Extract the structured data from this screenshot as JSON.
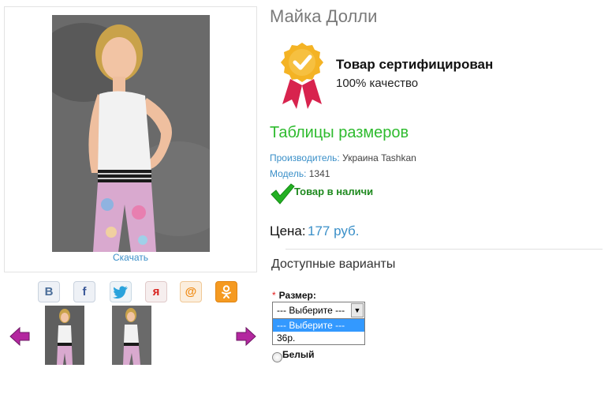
{
  "product": {
    "title": "Майка Долли",
    "download_label": "Скачать",
    "certificate": {
      "title": "Товар сертифицирован",
      "subtitle": "100% качество"
    },
    "size_tables_link": "Таблицы размеров",
    "manufacturer_label": "Производитель:",
    "manufacturer_value": "Украина Tashkan",
    "model_label": "Модель:",
    "model_value": "1341",
    "stock_status": "Товар в наличи",
    "price_label": "Цена:",
    "price_value": "177 руб."
  },
  "social": [
    {
      "icon": "vk-icon",
      "glyph": "В"
    },
    {
      "icon": "facebook-icon",
      "glyph": "f"
    },
    {
      "icon": "twitter-icon",
      "glyph": "🐦"
    },
    {
      "icon": "yaru-icon",
      "glyph": "я"
    },
    {
      "icon": "mailru-icon",
      "glyph": "@"
    },
    {
      "icon": "odnoklassniki-icon",
      "glyph": "ок"
    }
  ],
  "options": {
    "heading": "Доступные варианты",
    "size_required_mark": "*",
    "size_label": "Размер:",
    "size_selected": "--- Выберите ---",
    "size_options": [
      "--- Выберите ---",
      "36р."
    ],
    "color_option_label": "Белый"
  },
  "colors": {
    "accent_blue": "#3a8fc8",
    "accent_green": "#2ebb2e",
    "badge_gold": "#f4b324",
    "ribbon_red": "#d8234e",
    "arrow_purple": "#a0229a"
  }
}
